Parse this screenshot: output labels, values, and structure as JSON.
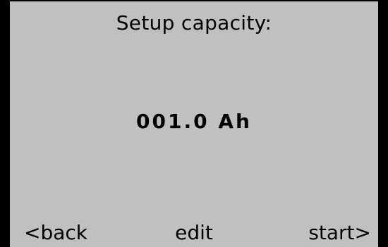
{
  "screen": {
    "title": "Setup capacity:",
    "value": "001.0 Ah"
  },
  "softkeys": {
    "back": "<back",
    "edit": "edit",
    "start": "start>"
  },
  "colors": {
    "background": "#c0c0c0",
    "frame": "#000000",
    "text": "#000000"
  }
}
